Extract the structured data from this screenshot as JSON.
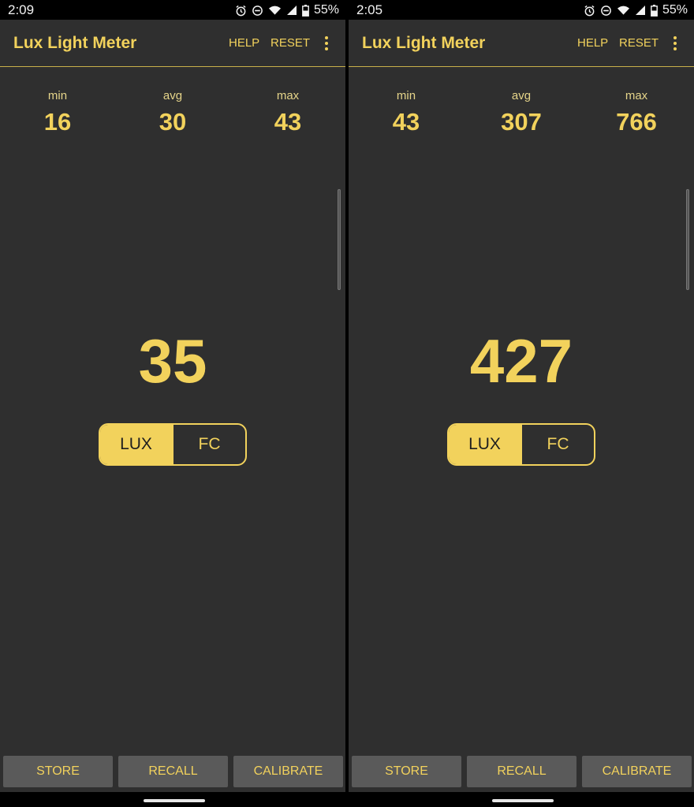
{
  "app": {
    "title": "Lux Light Meter",
    "help_label": "HELP",
    "reset_label": "RESET",
    "overflow_icon": "more-vert-icon",
    "accent_color": "#f2d25c",
    "background_color": "#2f2f2f"
  },
  "screens": [
    {
      "status": {
        "time": "2:09",
        "battery": "55%"
      },
      "stats": {
        "min_label": "min",
        "min": "16",
        "avg_label": "avg",
        "avg": "30",
        "max_label": "max",
        "max": "43"
      },
      "reading": "35",
      "unit_toggle": {
        "lux": "LUX",
        "fc": "FC",
        "selected": "LUX"
      },
      "buttons": {
        "store": "STORE",
        "recall": "RECALL",
        "calibrate": "CALIBRATE"
      }
    },
    {
      "status": {
        "time": "2:05",
        "battery": "55%"
      },
      "stats": {
        "min_label": "min",
        "min": "43",
        "avg_label": "avg",
        "avg": "307",
        "max_label": "max",
        "max": "766"
      },
      "reading": "427",
      "unit_toggle": {
        "lux": "LUX",
        "fc": "FC",
        "selected": "LUX"
      },
      "buttons": {
        "store": "STORE",
        "recall": "RECALL",
        "calibrate": "CALIBRATE"
      }
    }
  ]
}
